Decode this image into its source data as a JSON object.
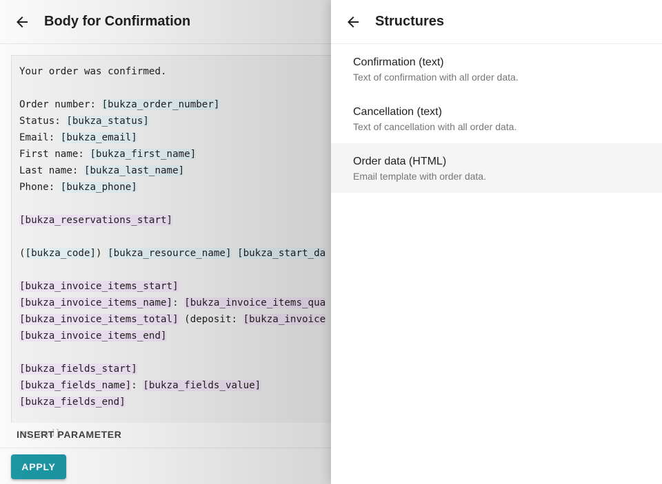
{
  "main": {
    "title": "Body for Confirmation",
    "code_lines": [
      [
        {
          "t": "Your order was confirmed."
        }
      ],
      [],
      [
        {
          "t": "Order number: "
        },
        {
          "t": "[bukza_order_number]",
          "c": "p"
        }
      ],
      [
        {
          "t": "Status: "
        },
        {
          "t": "[bukza_status]",
          "c": "p"
        }
      ],
      [
        {
          "t": "Email: "
        },
        {
          "t": "[bukza_email]",
          "c": "p"
        }
      ],
      [
        {
          "t": "First name: "
        },
        {
          "t": "[bukza_first_name]",
          "c": "p"
        }
      ],
      [
        {
          "t": "Last name: "
        },
        {
          "t": "[bukza_last_name]",
          "c": "p"
        }
      ],
      [
        {
          "t": "Phone: "
        },
        {
          "t": "[bukza_phone]",
          "c": "p"
        }
      ],
      [],
      [
        {
          "t": "[bukza_reservations_start]",
          "c": "s"
        }
      ],
      [],
      [
        {
          "t": "("
        },
        {
          "t": "[bukza_code]",
          "c": "p"
        },
        {
          "t": ") "
        },
        {
          "t": "[bukza_resource_name]",
          "c": "p"
        },
        {
          "t": " "
        },
        {
          "t": "[bukza_start_da",
          "c": "p"
        }
      ],
      [],
      [
        {
          "t": "[bukza_invoice_items_start]",
          "c": "s"
        }
      ],
      [
        {
          "t": "[bukza_invoice_items_name]",
          "c": "s"
        },
        {
          "t": ": "
        },
        {
          "t": "[bukza_invoice_items_qua",
          "c": "s"
        }
      ],
      [
        {
          "t": "[bukza_invoice_items_total]",
          "c": "s"
        },
        {
          "t": " (deposit: "
        },
        {
          "t": "[bukza_invoice",
          "c": "s"
        }
      ],
      [
        {
          "t": "[bukza_invoice_items_end]",
          "c": "s"
        }
      ],
      [],
      [
        {
          "t": "[bukza_fields_start]",
          "c": "s"
        }
      ],
      [
        {
          "t": "[bukza_fields_name]",
          "c": "s"
        },
        {
          "t": ": "
        },
        {
          "t": "[bukza_fields_value]",
          "c": "s"
        }
      ],
      [
        {
          "t": "[bukza_fields_end]",
          "c": "s"
        }
      ]
    ],
    "partial_line": "ns_end]",
    "insert_parameter_label": "INSERT PARAMETER",
    "apply_label": "APPLY"
  },
  "drawer": {
    "title": "Structures",
    "items": [
      {
        "title": "Confirmation (text)",
        "subtitle": "Text of confirmation with all order data."
      },
      {
        "title": "Cancellation (text)",
        "subtitle": "Text of cancellation with all order data."
      },
      {
        "title": "Order data (HTML)",
        "subtitle": "Email template with order data."
      }
    ],
    "active_index": 2
  },
  "icons": {
    "back": "arrow-left-icon"
  },
  "colors": {
    "accent": "#1d96a4",
    "param_highlight": "#e3f2f6",
    "section_highlight": "#f1e4f5"
  }
}
